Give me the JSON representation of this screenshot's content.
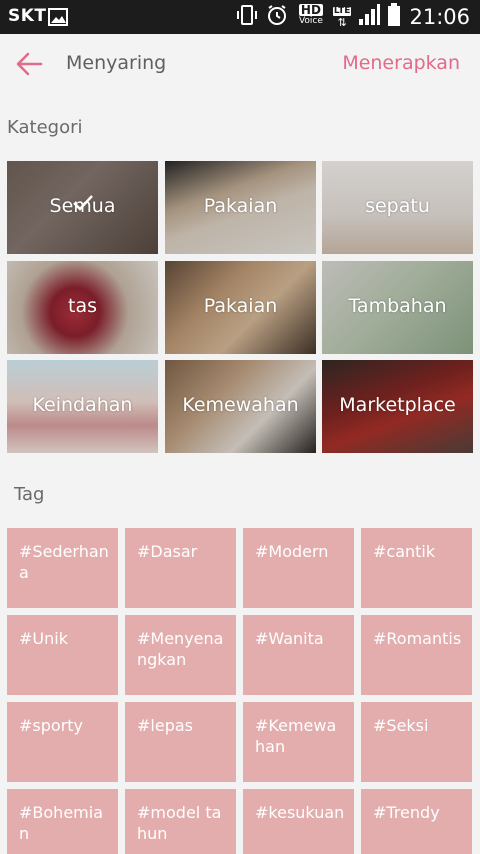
{
  "status_bar": {
    "carrier": "SKT",
    "hd_label": "HD",
    "voice_label": "Voice",
    "lte_label": "LTE",
    "time": "21:06",
    "icons": [
      "gallery-icon",
      "vibrate-icon",
      "alarm-icon",
      "signal-icon",
      "battery-icon"
    ]
  },
  "header": {
    "title": "Menyaring",
    "apply_label": "Menerapkan"
  },
  "categories": {
    "heading": "Kategori",
    "items": [
      {
        "label": "Semua",
        "selected": true
      },
      {
        "label": "Pakaian"
      },
      {
        "label": "sepatu"
      },
      {
        "label": "tas"
      },
      {
        "label": "Pakaian"
      },
      {
        "label": "Tambahan"
      },
      {
        "label": "Keindahan"
      },
      {
        "label": "Kemewahan"
      },
      {
        "label": "Marketplace"
      }
    ]
  },
  "tags": {
    "heading": "Tag",
    "items": [
      "#Sederhana",
      "#Dasar",
      "#Modern",
      "#cantik",
      "#Unik",
      "#Menyenangkan",
      "#Wanita",
      "#Romantis",
      "#sporty",
      "#lepas",
      "#Kemewahan",
      "#Seksi",
      "#Bohemian",
      "#model tahun",
      "#kesukuan",
      "#Trendy"
    ]
  },
  "colors": {
    "accent": "#e26a8a",
    "tag_bg": "#e3adad",
    "statusbar_bg": "#1c1c1c",
    "background": "#f3f3f3"
  }
}
